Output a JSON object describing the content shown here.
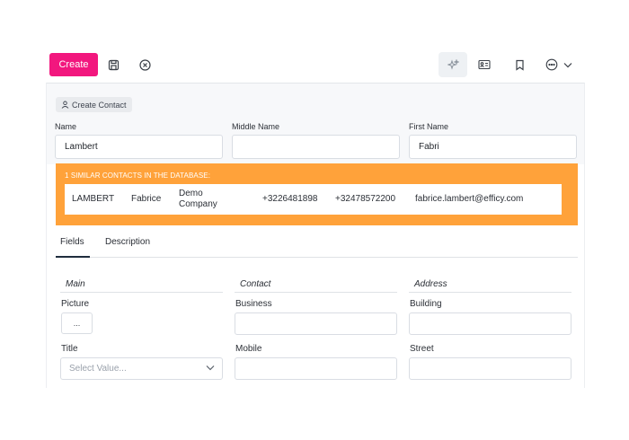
{
  "toolbar": {
    "create_label": "Create",
    "icons": [
      "save-icon",
      "cancel-circle-icon",
      "ai-sparkle-icon",
      "contact-card-icon",
      "bookmark-icon",
      "more-options-icon",
      "chevron-down-icon"
    ]
  },
  "header": {
    "badge_label": "Create Contact",
    "fields": [
      {
        "label": "Name",
        "value": "Lambert"
      },
      {
        "label": "Middle Name",
        "value": ""
      },
      {
        "label": "First Name",
        "value": "Fabri"
      }
    ]
  },
  "duplicates": {
    "title": "1 SIMILAR CONTACTS IN THE DATABASE:",
    "rows": [
      {
        "last_name": "LAMBERT",
        "first_name": "Fabrice",
        "company": "Demo Company",
        "phone": "+3226481898",
        "mobile": "+32478572200",
        "email": "fabrice.lambert@efficy.com"
      }
    ]
  },
  "tabs": [
    {
      "label": "Fields",
      "active": true
    },
    {
      "label": "Description",
      "active": false
    }
  ],
  "sections": {
    "main": {
      "title": "Main",
      "picture_label": "Picture",
      "picture_button": "...",
      "title_label": "Title",
      "title_placeholder": "Select Value..."
    },
    "contact": {
      "title": "Contact",
      "business_label": "Business",
      "business_value": "",
      "mobile_label": "Mobile",
      "mobile_value": ""
    },
    "address": {
      "title": "Address",
      "building_label": "Building",
      "building_value": "",
      "street_label": "Street",
      "street_value": ""
    }
  },
  "colors": {
    "accent": "#f2177e",
    "warning": "#ffa23a",
    "tab_indicator": "#1f2d3d"
  }
}
